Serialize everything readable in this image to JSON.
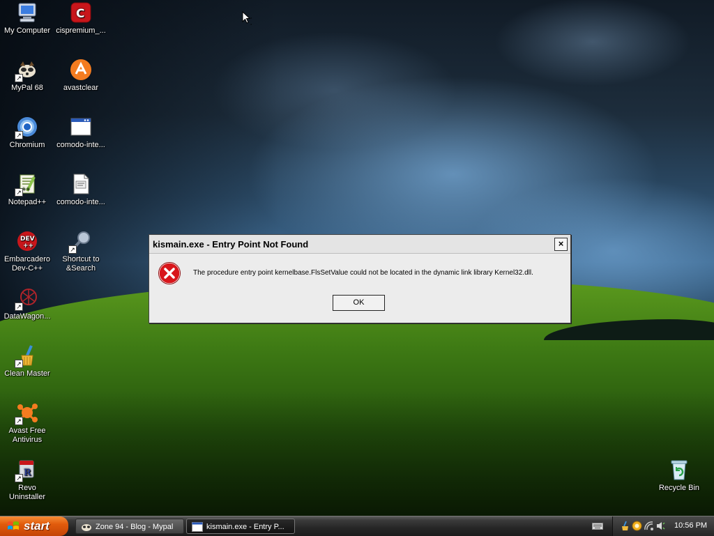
{
  "desktop_icons": [
    {
      "label": "My Computer",
      "icon": "computer-icon"
    },
    {
      "label": "cispremium_...",
      "icon": "comodo-icon"
    },
    {
      "label": "MyPal 68",
      "icon": "mypal-icon"
    },
    {
      "label": "avastclear",
      "icon": "avast-icon"
    },
    {
      "label": "Chromium",
      "icon": "chromium-icon"
    },
    {
      "label": "comodo-inte...",
      "icon": "window-icon"
    },
    {
      "label": "Notepad++",
      "icon": "notepad-plus-icon"
    },
    {
      "label": "comodo-inte...",
      "icon": "document-icon"
    },
    {
      "label": "Embarcadero Dev-C++",
      "icon": "devcpp-icon"
    },
    {
      "label": "Shortcut to &Search",
      "icon": "search-icon"
    },
    {
      "label": "DataWagon...",
      "icon": "datawagon-icon"
    },
    {
      "label": "Clean Master",
      "icon": "broom-icon"
    },
    {
      "label": "Avast Free Antivirus",
      "icon": "avast-icon"
    },
    {
      "label": "Revo Uninstaller",
      "icon": "revo-icon"
    },
    {
      "label": "Recycle Bin",
      "icon": "recycle-bin-icon"
    }
  ],
  "dialog": {
    "title": "kismain.exe - Entry Point Not Found",
    "close_label": "×",
    "message": "The procedure entry point kernelbase.FlsSetValue could not be located in the dynamic link library Kernel32.dll.",
    "ok_label": "OK"
  },
  "taskbar": {
    "start_label": "start",
    "tasks": [
      {
        "label": "Zone 94 - Blog - Mypal",
        "icon": "mypal-icon",
        "active": false
      },
      {
        "label": "kismain.exe - Entry P...",
        "icon": "window-icon",
        "active": true
      }
    ],
    "clock": "10:56 PM"
  },
  "colors": {
    "start_orange": "#e15b0c",
    "error_red": "#d8161b",
    "dialog_bg": "#ececec"
  }
}
